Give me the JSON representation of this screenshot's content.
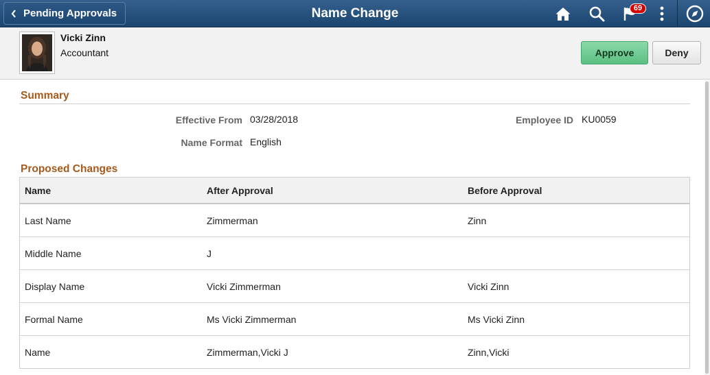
{
  "header": {
    "back_label": "Pending Approvals",
    "title": "Name Change",
    "notification_count": "69",
    "icons": [
      "home-icon",
      "search-icon",
      "flag-icon",
      "more-options-icon",
      "navbar-compass-icon"
    ]
  },
  "employee": {
    "name": "Vicki Zinn",
    "job_title": "Accountant"
  },
  "actions": {
    "approve_label": "Approve",
    "deny_label": "Deny"
  },
  "summary": {
    "title": "Summary",
    "effective_from_label": "Effective From",
    "effective_from_value": "03/28/2018",
    "name_format_label": "Name Format",
    "name_format_value": "English",
    "employee_id_label": "Employee ID",
    "employee_id_value": "KU0059"
  },
  "proposed_changes": {
    "title": "Proposed Changes",
    "columns": [
      "Name",
      "After Approval",
      "Before Approval"
    ],
    "rows": [
      [
        "Last Name",
        "Zimmerman",
        "Zinn"
      ],
      [
        "Middle Name",
        "J",
        ""
      ],
      [
        "Display Name",
        "Vicki Zimmerman",
        "Vicki Zinn"
      ],
      [
        "Formal Name",
        "Ms Vicki Zimmerman",
        "Ms Vicki Zinn"
      ],
      [
        "Name",
        "Zimmerman,Vicki J",
        "Zinn,Vicki"
      ]
    ]
  },
  "colors": {
    "header_bg": "#1b4670",
    "section_title": "#a6591d",
    "approve_button": "#6fcf97",
    "badge": "#d40000"
  }
}
